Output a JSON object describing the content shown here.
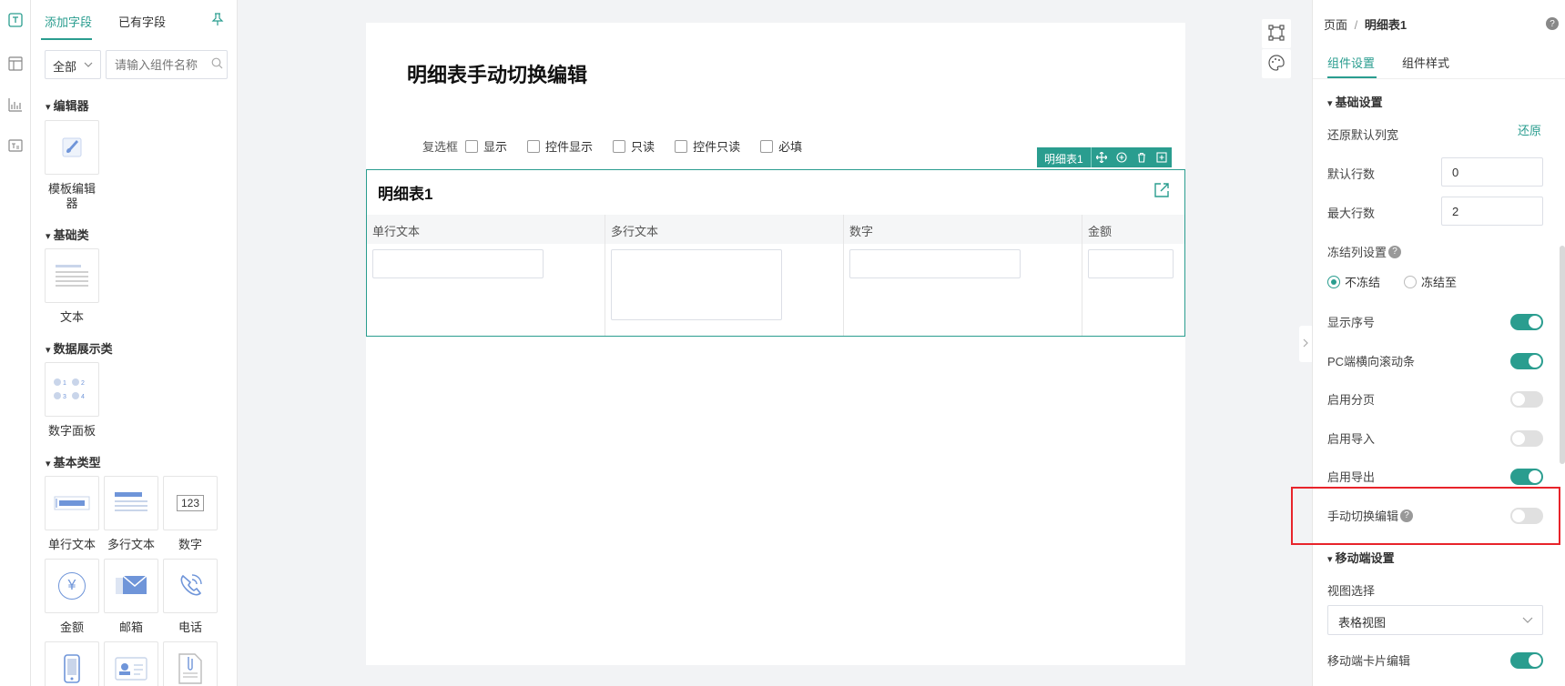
{
  "left_panel": {
    "tabs": [
      "添加字段",
      "已有字段"
    ],
    "filter": "全部",
    "search_placeholder": "请输入组件名称",
    "sections": [
      {
        "title": "编辑器",
        "items": [
          "模板编辑器"
        ]
      },
      {
        "title": "基础类",
        "items": [
          "文本"
        ]
      },
      {
        "title": "数据展示类",
        "items": [
          "数字面板"
        ]
      },
      {
        "title": "基本类型",
        "items": [
          "单行文本",
          "多行文本",
          "数字",
          "金额",
          "邮箱",
          "电话"
        ]
      }
    ],
    "number_icon_text": "123",
    "currency_symbol": "¥"
  },
  "canvas": {
    "form_title": "明细表手动切换编辑",
    "checkbox_group_label": "复选框",
    "checkbox_options": [
      "显示",
      "控件显示",
      "只读",
      "控件只读",
      "必填"
    ],
    "toolbar_name": "明细表1",
    "table_title": "明细表1",
    "columns": [
      "单行文本",
      "多行文本",
      "数字",
      "金额"
    ]
  },
  "right_panel": {
    "breadcrumb_root": "页面",
    "breadcrumb_sep": "/",
    "breadcrumb_current": "明细表1",
    "tabs": [
      "组件设置",
      "组件样式"
    ],
    "basic_section": "基础设置",
    "reset_width_label": "还原默认列宽",
    "reset_link": "还原",
    "default_rows_label": "默认行数",
    "default_rows": "0",
    "max_rows_label": "最大行数",
    "max_rows": "2",
    "freeze_label": "冻结列设置",
    "freeze_options": [
      "不冻结",
      "冻结至"
    ],
    "freeze_selected": 0,
    "toggles": [
      {
        "label": "显示序号",
        "on": true
      },
      {
        "label": "PC端横向滚动条",
        "on": true
      },
      {
        "label": "启用分页",
        "on": false
      },
      {
        "label": "启用导入",
        "on": false
      },
      {
        "label": "启用导出",
        "on": true
      },
      {
        "label": "手动切换编辑",
        "on": false
      }
    ],
    "mobile_section": "移动端设置",
    "view_label": "视图选择",
    "view_value": "表格视图",
    "mobile_card_label": "移动端卡片编辑",
    "mobile_card_on": true
  },
  "colors": {
    "accent": "#2a9d8f",
    "highlight": "#e8242b"
  }
}
